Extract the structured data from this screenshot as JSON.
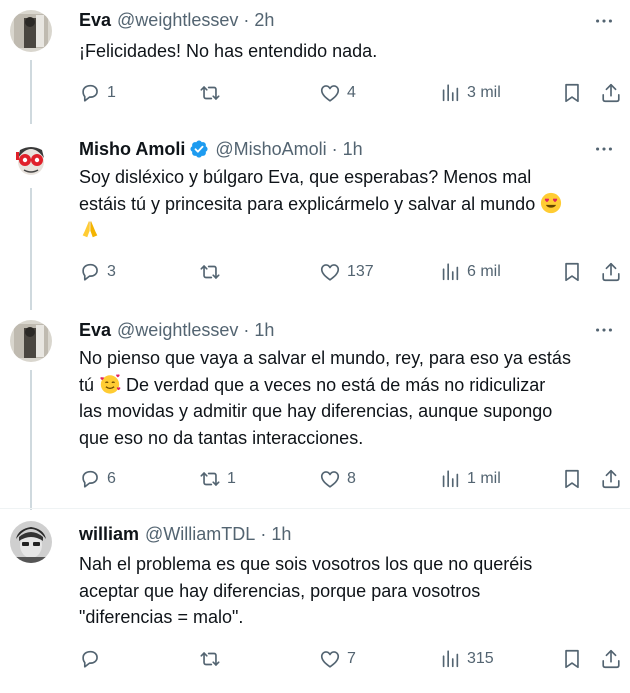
{
  "tweets": [
    {
      "name": "Eva",
      "handle": "@weightlessev",
      "dot": "·",
      "time": "2h",
      "text": "¡Felicidades! No has entendido nada.",
      "replies": "1",
      "retweets": "",
      "likes": "4",
      "views": "3 mil",
      "verified": false
    },
    {
      "name": "Misho Amoli",
      "handle": "@MishoAmoli",
      "dot": "·",
      "time": "1h",
      "text_line1": "Soy disléxico y búlgaro Eva, que esperabas? Menos mal",
      "text_line2": "estáis tú y princesita para explicármelo y salvar al mundo",
      "replies": "3",
      "retweets": "",
      "likes": "137",
      "views": "6 mil",
      "verified": true
    },
    {
      "name": "Eva",
      "handle": "@weightlessev",
      "dot": "·",
      "time": "1h",
      "text_line1": "No pienso que vaya a salvar el mundo, rey, para eso ya estás",
      "text_line2a": "tú",
      "text_line2b": "De verdad que a veces no está de más no ridiculizar",
      "text_line3": "las movidas y admitir que hay diferencias, aunque supongo",
      "text_line4": "que eso no da tantas interacciones.",
      "replies": "6",
      "retweets": "1",
      "likes": "8",
      "views": "1 mil",
      "verified": false
    },
    {
      "name": "william",
      "handle": "@WilliamTDL",
      "dot": "·",
      "time": "1h",
      "text_line1": "Nah el problema es que sois vosotros los que no queréis",
      "text_line2": "aceptar que hay diferencias, porque para vosotros",
      "text_line3": "\"diferencias = malo\".",
      "replies": "",
      "retweets": "",
      "likes": "7",
      "views": "315",
      "verified": false
    }
  ],
  "icons": {
    "reply": "reply-icon",
    "retweet": "retweet-icon",
    "like": "heart-icon",
    "views": "views-icon",
    "bookmark": "bookmark-icon",
    "share": "share-icon",
    "more": "more-icon",
    "verified": "verified-badge-icon",
    "emoji_heart_eyes": "heart-eyes-emoji",
    "emoji_pray": "folded-hands-emoji",
    "emoji_smiling_hearts": "smiling-face-with-hearts-emoji"
  },
  "colors": {
    "text": "#0f1419",
    "secondary": "#536471",
    "verified": "#1d9bf0",
    "divider": "#eff3f4",
    "thread_line": "#cfd9de"
  }
}
